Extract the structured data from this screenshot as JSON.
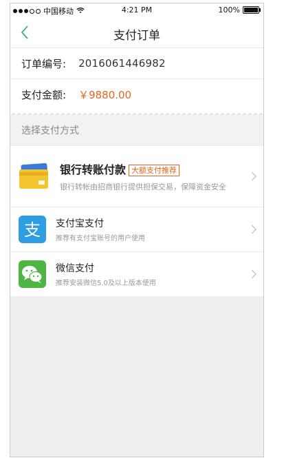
{
  "status_bar": {
    "carrier": "中国移动",
    "time": "4:21 PM",
    "battery": "100%"
  },
  "nav": {
    "title": "支付订单"
  },
  "order": {
    "number_label": "订单编号:",
    "number_value": "2016061446982",
    "amount_label": "支付金额:",
    "amount_value": "￥9880.00"
  },
  "methods_header": "选择支付方式",
  "methods": [
    {
      "name": "银行转账付款",
      "badge": "大额支付推荐",
      "desc": "银行转帐由招商银行提供担保交易，保障资金安全",
      "icon": "bank-card-icon"
    },
    {
      "name": "支付宝支付",
      "desc": "推荐有支付宝账号的用户使用",
      "icon": "alipay-icon"
    },
    {
      "name": "微信支付",
      "desc": "推荐安装微信5.0及以上版本使用",
      "icon": "wechat-icon"
    }
  ],
  "colors": {
    "accent_orange": "#e8641b",
    "alipay_blue": "#2f9de2",
    "wechat_green": "#4cb543",
    "back_green": "#3cb371"
  }
}
